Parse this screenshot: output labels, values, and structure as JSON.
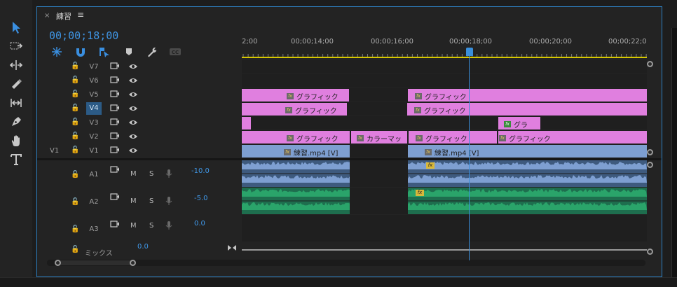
{
  "toolbar": {
    "tools": [
      "selection-tool-icon",
      "track-select-forward-icon",
      "ripple-edit-icon",
      "razor-icon",
      "slip-icon",
      "pen-icon",
      "hand-icon",
      "type-icon"
    ]
  },
  "panel": {
    "close": "×",
    "title": "練習",
    "menu": "≡",
    "timecode": "00;00;18;00"
  },
  "ruler": {
    "labels": [
      "2;00",
      "00;00;14;00",
      "00;00;16;00",
      "00;00;18;00",
      "00;00;20;00",
      "00;00;22;0"
    ]
  },
  "video_tracks": [
    {
      "name": "V7",
      "source": "",
      "selected": false
    },
    {
      "name": "V6",
      "source": "",
      "selected": false
    },
    {
      "name": "V5",
      "source": "",
      "selected": false
    },
    {
      "name": "V4",
      "source": "",
      "selected": true
    },
    {
      "name": "V3",
      "source": "",
      "selected": false
    },
    {
      "name": "V2",
      "source": "",
      "selected": false
    },
    {
      "name": "V1",
      "source": "V1",
      "selected": false
    }
  ],
  "clips": {
    "v5_a": "グラフィック",
    "v5_b": "グラフィック",
    "v4_a": "グラフィック",
    "v4_b": "グラフィック",
    "v3_a": "グラ",
    "v2_a": "グラフィック",
    "v2_b": "カラーマッ",
    "v2_c": "グラフィック",
    "v2_d": "グラフィック",
    "v1_a": "練習.mp4 [V]",
    "v1_b": "練習.mp4 [V]"
  },
  "audio_tracks": [
    {
      "name": "A1",
      "m": "M",
      "s": "S",
      "volume": "-10.0"
    },
    {
      "name": "A2",
      "m": "M",
      "s": "S",
      "volume": "-5.0"
    },
    {
      "name": "A3",
      "m": "M",
      "s": "S",
      "volume": "0.0"
    }
  ],
  "mix": {
    "label": "ミックス",
    "value": "0.0"
  },
  "colors": {
    "accent": "#3f95e4",
    "graphic_clip": "#e07fdf",
    "video_clip": "#7e9fd1",
    "audio_a1": "#7e9fd1",
    "audio_a2": "#2aa46a",
    "work_area": "#d6c700"
  }
}
